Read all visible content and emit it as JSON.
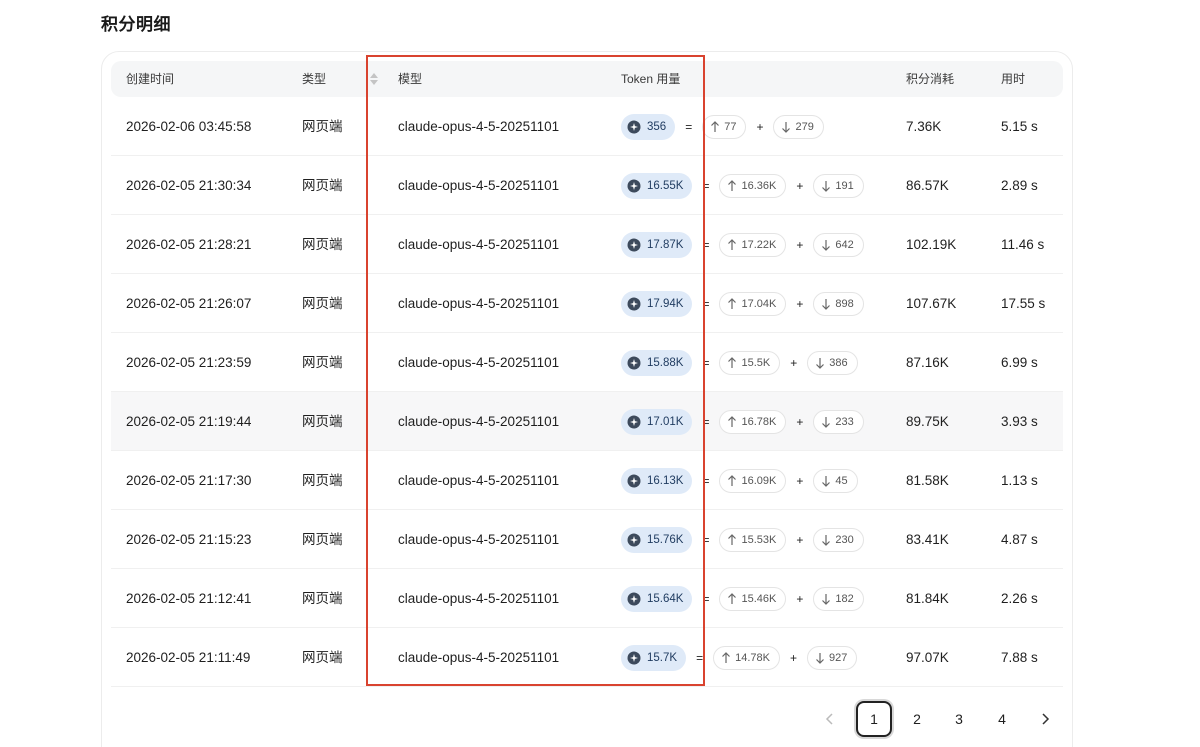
{
  "page": {
    "title": "积分明细"
  },
  "table": {
    "columns": {
      "created_time": "创建时间",
      "type": "类型",
      "model": "模型",
      "token_usage": "Token 用量",
      "credits": "积分消耗",
      "duration": "用时"
    },
    "rows": [
      {
        "time": "2026-02-06 03:45:58",
        "type": "网页端",
        "model": "claude-opus-4-5-20251101",
        "total": "356",
        "input": "77",
        "output": "279",
        "credits": "7.36K",
        "duration": "5.15 s"
      },
      {
        "time": "2026-02-05 21:30:34",
        "type": "网页端",
        "model": "claude-opus-4-5-20251101",
        "total": "16.55K",
        "input": "16.36K",
        "output": "191",
        "credits": "86.57K",
        "duration": "2.89 s"
      },
      {
        "time": "2026-02-05 21:28:21",
        "type": "网页端",
        "model": "claude-opus-4-5-20251101",
        "total": "17.87K",
        "input": "17.22K",
        "output": "642",
        "credits": "102.19K",
        "duration": "11.46 s"
      },
      {
        "time": "2026-02-05 21:26:07",
        "type": "网页端",
        "model": "claude-opus-4-5-20251101",
        "total": "17.94K",
        "input": "17.04K",
        "output": "898",
        "credits": "107.67K",
        "duration": "17.55 s"
      },
      {
        "time": "2026-02-05 21:23:59",
        "type": "网页端",
        "model": "claude-opus-4-5-20251101",
        "total": "15.88K",
        "input": "15.5K",
        "output": "386",
        "credits": "87.16K",
        "duration": "6.99 s"
      },
      {
        "time": "2026-02-05 21:19:44",
        "type": "网页端",
        "model": "claude-opus-4-5-20251101",
        "total": "17.01K",
        "input": "16.78K",
        "output": "233",
        "credits": "89.75K",
        "duration": "3.93 s"
      },
      {
        "time": "2026-02-05 21:17:30",
        "type": "网页端",
        "model": "claude-opus-4-5-20251101",
        "total": "16.13K",
        "input": "16.09K",
        "output": "45",
        "credits": "81.58K",
        "duration": "1.13 s"
      },
      {
        "time": "2026-02-05 21:15:23",
        "type": "网页端",
        "model": "claude-opus-4-5-20251101",
        "total": "15.76K",
        "input": "15.53K",
        "output": "230",
        "credits": "83.41K",
        "duration": "4.87 s"
      },
      {
        "time": "2026-02-05 21:12:41",
        "type": "网页端",
        "model": "claude-opus-4-5-20251101",
        "total": "15.64K",
        "input": "15.46K",
        "output": "182",
        "credits": "81.84K",
        "duration": "2.26 s"
      },
      {
        "time": "2026-02-05 21:11:49",
        "type": "网页端",
        "model": "claude-opus-4-5-20251101",
        "total": "15.7K",
        "input": "14.78K",
        "output": "927",
        "credits": "97.07K",
        "duration": "7.88 s"
      }
    ],
    "symbols": {
      "equals": "=",
      "plus": "+"
    }
  },
  "pagination": {
    "pages": [
      "1",
      "2",
      "3",
      "4"
    ],
    "current": "1",
    "prev_icon": "chevron-left-icon",
    "next_icon": "chevron-right-icon"
  },
  "colors": {
    "highlight_border": "#d9432f",
    "token_badge_bg": "#dfeaf8",
    "token_badge_text": "#1e3a5f"
  }
}
